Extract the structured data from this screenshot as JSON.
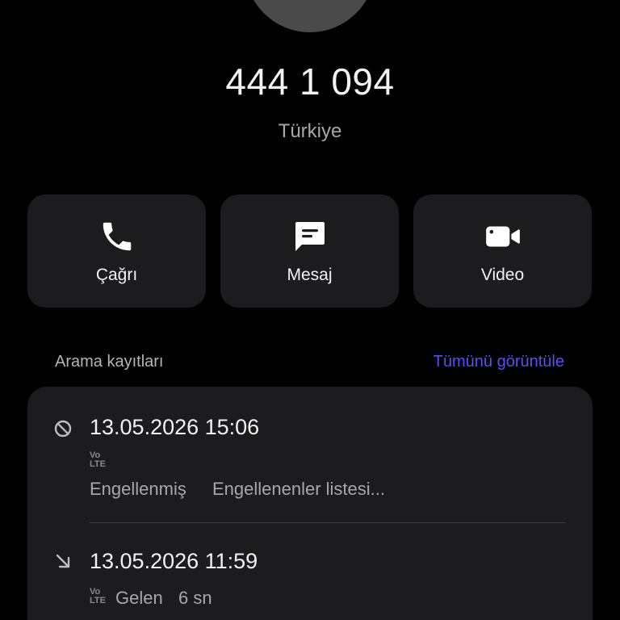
{
  "contact": {
    "number": "444 1 094",
    "country": "Türkiye"
  },
  "actions": [
    {
      "label": "Çağrı",
      "icon": "phone-icon"
    },
    {
      "label": "Mesaj",
      "icon": "message-icon"
    },
    {
      "label": "Video",
      "icon": "video-camera-icon"
    }
  ],
  "call_log": {
    "title": "Arama kayıtları",
    "view_all": "Tümünü görüntüle",
    "entries": [
      {
        "icon": "blocked-icon",
        "datetime": "13.05.2026 15:06",
        "network_badge": [
          "Vo",
          "LTE"
        ],
        "status": "Engellenmiş",
        "detail": "Engellenenler listesi..."
      },
      {
        "icon": "incoming-call-icon",
        "datetime": "13.05.2026 11:59",
        "network_badge": [
          "Vo",
          "LTE"
        ],
        "status": "Gelen",
        "detail": "6 sn"
      }
    ]
  },
  "colors": {
    "background": "#000000",
    "card": "#1c1c1e",
    "accent": "#5b4cf5",
    "secondary_text": "#a8a8a8"
  }
}
